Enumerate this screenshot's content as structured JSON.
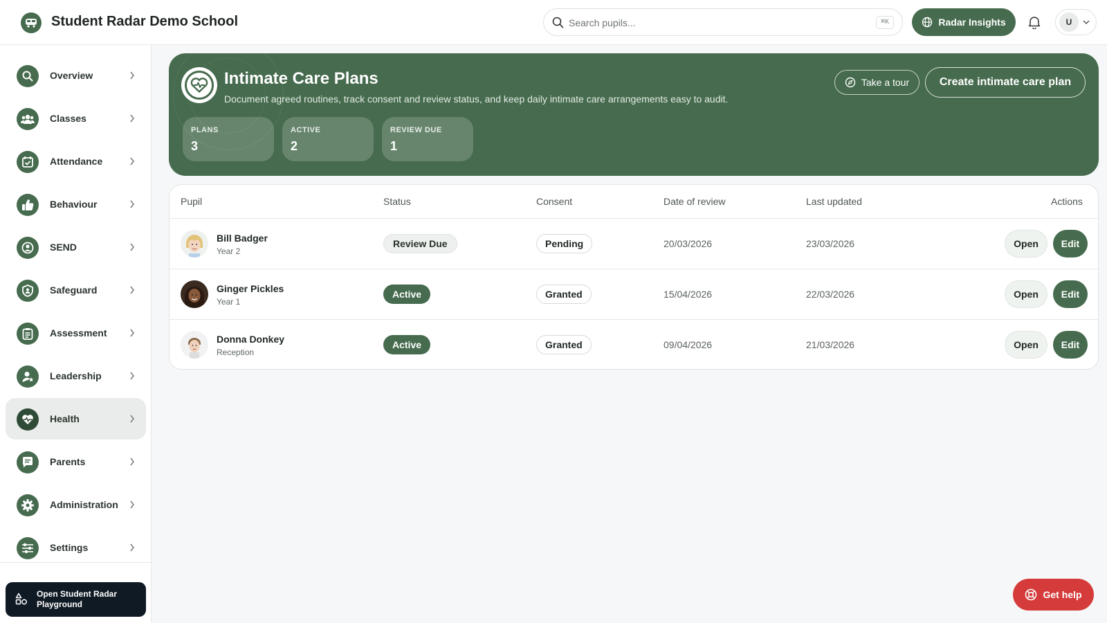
{
  "header": {
    "school_name": "Student Radar Demo School",
    "search_placeholder": "Search pupils...",
    "search_shortcut": "⌘K",
    "insights_label": "Radar Insights",
    "avatar_initial": "U"
  },
  "sidebar": {
    "items": [
      {
        "label": "Overview",
        "icon": "search-icon"
      },
      {
        "label": "Classes",
        "icon": "users-icon"
      },
      {
        "label": "Attendance",
        "icon": "calendar-check-icon"
      },
      {
        "label": "Behaviour",
        "icon": "thumbs-up-icon"
      },
      {
        "label": "SEND",
        "icon": "user-circle-icon"
      },
      {
        "label": "Safeguard",
        "icon": "shield-icon"
      },
      {
        "label": "Assessment",
        "icon": "clipboard-icon"
      },
      {
        "label": "Leadership",
        "icon": "user-star-icon"
      },
      {
        "label": "Health",
        "icon": "heart-pulse-icon",
        "active": true
      },
      {
        "label": "Parents",
        "icon": "chat-icon"
      },
      {
        "label": "Administration",
        "icon": "gear-icon"
      },
      {
        "label": "Settings",
        "icon": "sliders-icon"
      }
    ],
    "playground_label": "Open Student Radar Playground"
  },
  "hero": {
    "title": "Intimate Care Plans",
    "subtitle": "Document agreed routines, track consent and review status, and keep daily intimate care arrangements easy to audit.",
    "tour_label": "Take a tour",
    "create_label": "Create intimate care plan",
    "stats": [
      {
        "label": "PLANS",
        "value": "3"
      },
      {
        "label": "ACTIVE",
        "value": "2"
      },
      {
        "label": "REVIEW DUE",
        "value": "1"
      }
    ]
  },
  "table": {
    "headers": {
      "pupil": "Pupil",
      "status": "Status",
      "consent": "Consent",
      "review_date": "Date of review",
      "last_updated": "Last updated",
      "actions": "Actions"
    },
    "rows": [
      {
        "name": "Bill Badger",
        "year": "Year 2",
        "status": "Review Due",
        "consent": "Pending",
        "review_date": "20/03/2026",
        "last_updated": "23/03/2026",
        "open_label": "Open",
        "edit_label": "Edit"
      },
      {
        "name": "Ginger Pickles",
        "year": "Year 1",
        "status": "Active",
        "consent": "Granted",
        "review_date": "15/04/2026",
        "last_updated": "22/03/2026",
        "open_label": "Open",
        "edit_label": "Edit"
      },
      {
        "name": "Donna Donkey",
        "year": "Reception",
        "status": "Active",
        "consent": "Granted",
        "review_date": "09/04/2026",
        "last_updated": "21/03/2026",
        "open_label": "Open",
        "edit_label": "Edit"
      }
    ]
  },
  "help_label": "Get help",
  "colors": {
    "brand": "#466b4e",
    "help": "#d53b3b",
    "playground": "#101a25"
  }
}
